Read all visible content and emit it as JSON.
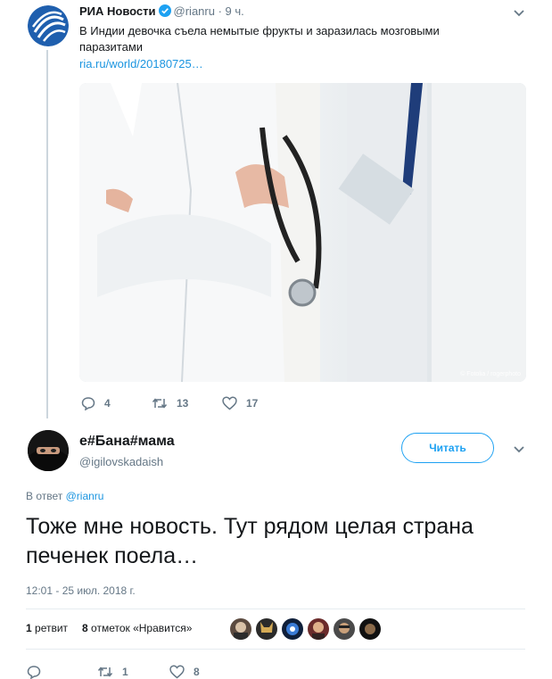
{
  "parent_tweet": {
    "author_name": "РИА Новости",
    "handle": "@rianru",
    "time": "· 9 ч.",
    "text": "В Индии девочка съела немытые фрукты и заразилась мозговыми паразитами",
    "link": "ria.ru/world/20180725…",
    "photo_credit": "© Fotolia / rogerphoto",
    "actions": {
      "replies": "4",
      "retweets": "13",
      "likes": "17"
    }
  },
  "reply_tweet": {
    "author_name": "е#Бана#мама",
    "handle": "@igilovskadaish",
    "follow_label": "Читать",
    "reply_prefix": "В ответ",
    "reply_mention": "@rianru",
    "text": "Тоже мне новость. Тут рядом целая страна печенек поела…",
    "timestamp": "12:01 - 25 июл. 2018 г.",
    "retweet_count": "1",
    "retweet_label": "ретвит",
    "like_count": "8",
    "like_label": "отметок «Нравится»",
    "actions": {
      "replies": "",
      "retweets": "1",
      "likes": "8"
    }
  },
  "colors": {
    "accent": "#1da1f2",
    "link": "#1b95e0",
    "secondary_text": "#657786",
    "divider": "#e6ecf0"
  }
}
